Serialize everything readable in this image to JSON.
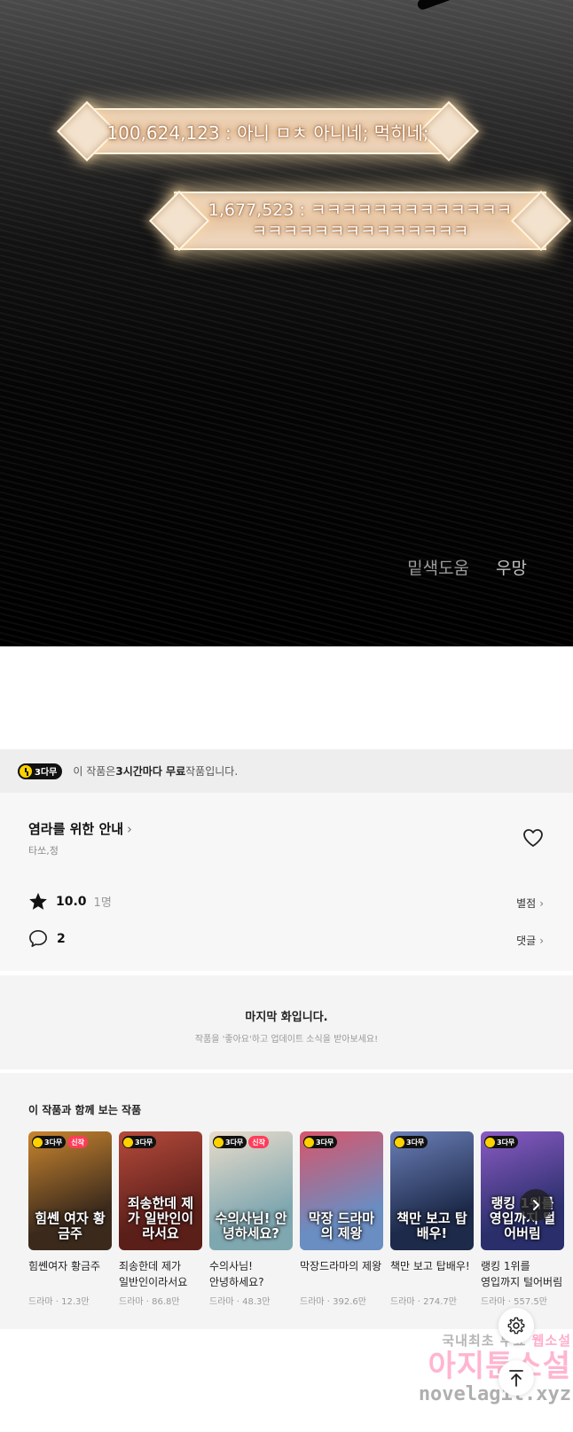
{
  "comic": {
    "banner1": "100,624,123 : 아니 ㅁㅊ 아니네; 먹히네;",
    "banner2_line1": "1,677,523 : ㅋㅋㅋㅋㅋㅋㅋㅋㅋㅋㅋㅋㅋ",
    "banner2_line2": "ㅋㅋㅋㅋㅋㅋㅋㅋㅋㅋㅋㅋㅋㅋ",
    "credit1": "밑색도움",
    "credit2": "우망"
  },
  "free_notice": {
    "badge": "3다무",
    "prefix": "이 작품은 ",
    "emphasis": "3시간마다 무료",
    "suffix": " 작품입니다."
  },
  "work": {
    "title": "염라를 위한 안내",
    "title_chevron": "›",
    "authors": "타쏘,정",
    "rating": "10.0",
    "rating_count": "1명",
    "rating_link": "별점",
    "comment_count": "2",
    "comment_link": "댓글",
    "chevron": "›"
  },
  "last_episode": {
    "heading": "마지막 화입니다.",
    "subtext": "작품을 '좋아요'하고 업데이트 소식을 받아보세요!"
  },
  "recommendations": {
    "title": "이 작품과 함께 보는 작품",
    "badge": "3다무",
    "new_badge": "신작",
    "items": [
      {
        "name": "힘쎈여자 황금주",
        "genre_views": "드라마 · 12.3만",
        "cover_text": "힘쎈 여자 황금주",
        "is_new": true,
        "bg": "#3b2a1c",
        "bg2": "#c9852f"
      },
      {
        "name": "죄송한데 제가 일반인이라서요",
        "genre_views": "드라마 · 86.8만",
        "cover_text": "죄송한데 제가 일반인이라서요",
        "is_new": false,
        "bg": "#5b1f1a",
        "bg2": "#b54a3b"
      },
      {
        "name": "수의사님! 안녕하세요?",
        "genre_views": "드라마 · 48.3만",
        "cover_text": "수의사님! 안녕하세요?",
        "is_new": true,
        "bg": "#7fa7b0",
        "bg2": "#e9dccb"
      },
      {
        "name": "막장드라마의 제왕",
        "genre_views": "드라마 · 392.6만",
        "cover_text": "막장 드라마의 제왕",
        "is_new": false,
        "bg": "#6a8dc2",
        "bg2": "#d8556a"
      },
      {
        "name": "책만 보고 탑배우!",
        "genre_views": "드라마 · 274.7만",
        "cover_text": "책만 보고 탑배우!",
        "is_new": false,
        "bg": "#1d2a4a",
        "bg2": "#6b7fb8"
      },
      {
        "name": "랭킹 1위를 영입까지 털어버림",
        "genre_views": "드라마 · 557.5만",
        "cover_text": "랭킹 1위를 영입까지 털어버림",
        "is_new": false,
        "bg": "#2a2f6b",
        "bg2": "#8b5bc4"
      }
    ]
  },
  "watermark": {
    "line1_a": "국내최초 무료 ",
    "line1_b": "웹소설",
    "line2": "아지툰소설",
    "line3": "novelagit.xyz"
  },
  "colors": {
    "badge_yellow": "#ffd200",
    "new_badge_red": "#ff3d5a"
  }
}
